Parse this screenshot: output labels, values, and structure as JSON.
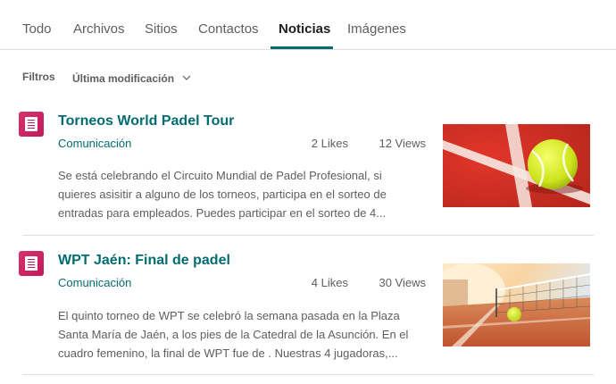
{
  "tabs": [
    {
      "label": "Todo"
    },
    {
      "label": "Archivos"
    },
    {
      "label": "Sitios"
    },
    {
      "label": "Contactos"
    },
    {
      "label": "Noticias",
      "active": true
    },
    {
      "label": "Imágenes"
    }
  ],
  "filters": {
    "label": "Filtros",
    "sort_label": "Última modificación"
  },
  "results": [
    {
      "title": "Torneos World Padel Tour",
      "site": "Comunicación",
      "likes": "2 Likes",
      "views": "12 Views",
      "snippet_lines": [
        "Se está celebrando el Circuito Mundial de Padel Profesional, si",
        "quieres asisitir a alguno de los torneos, participa en el sorteo de",
        "entradas para empleados. Puedes participar en el sorteo de 4..."
      ],
      "thumbnail": "tennis-ball-on-clay-court-image"
    },
    {
      "title": "WPT Jaén: Final de padel",
      "site": "Comunicación",
      "likes": "4 Likes",
      "views": "30 Views",
      "snippet_lines": [
        "El quinto torneo de WPT se celebró la semana pasada en la Plaza",
        "Santa María de Jaén, a los pies de la Catedral de la Asunción. En el",
        "cuadro femenino, la final de WPT fue de . Nuestras 4 jugadoras,..."
      ],
      "thumbnail": "tennis-court-net-sunset-image"
    }
  ],
  "colors": {
    "accent": "#036c70",
    "icon": "#c2185b",
    "divider": "#e1dfdd",
    "muted_text": "#605e5c"
  }
}
